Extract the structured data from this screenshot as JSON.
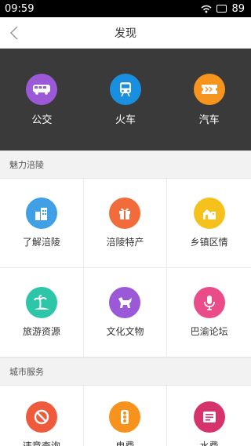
{
  "status": {
    "time": "09:59",
    "battery": "89"
  },
  "nav": {
    "title": "发现"
  },
  "transport": [
    {
      "label": "公交",
      "icon": "bus-icon",
      "color": "#9b59d8"
    },
    {
      "label": "火车",
      "icon": "train-icon",
      "color": "#1a8fe0"
    },
    {
      "label": "汽车",
      "icon": "ticket-icon",
      "color": "#f7941d"
    }
  ],
  "sections": {
    "charm": {
      "title": "魅力涪陵",
      "items": [
        {
          "label": "了解涪陵",
          "icon": "buildings-icon",
          "color": "#3fa0e6"
        },
        {
          "label": "涪陵特产",
          "icon": "gift-icon",
          "color": "#f26b3a"
        },
        {
          "label": "乡镇区情",
          "icon": "town-icon",
          "color": "#f5c11c"
        },
        {
          "label": "旅游资源",
          "icon": "palm-tree-icon",
          "color": "#2ec6a9"
        },
        {
          "label": "文化文物",
          "icon": "horse-icon",
          "color": "#9b59d8"
        },
        {
          "label": "巴渝论坛",
          "icon": "microphone-icon",
          "color": "#ea4c89"
        }
      ]
    },
    "city": {
      "title": "城市服务",
      "items": [
        {
          "label": "违章查询",
          "icon": "no-entry-icon",
          "color": "#ef5a3c"
        },
        {
          "label": "电费",
          "icon": "traffic-light-icon",
          "color": "#f7931d"
        },
        {
          "label": "水费",
          "icon": "bill-icon",
          "color": "#d6336c"
        }
      ]
    }
  }
}
